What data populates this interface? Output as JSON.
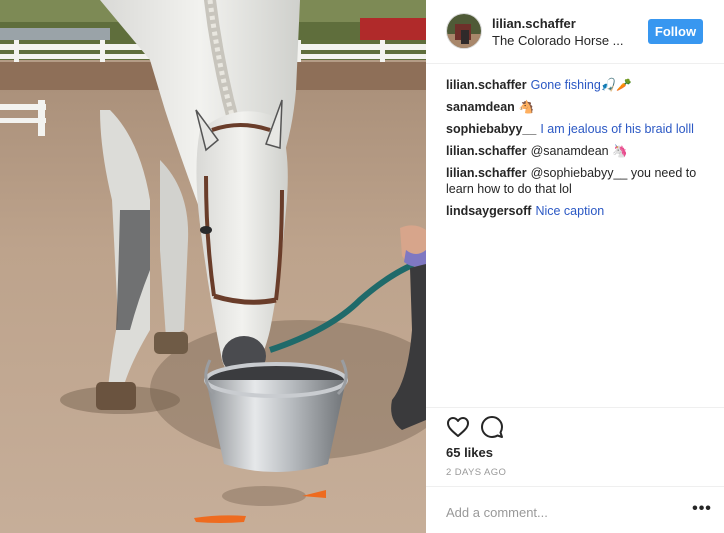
{
  "post": {
    "photo_alt": "",
    "author": {
      "username": "lilian.schaffer",
      "location": "The Colorado Horse ...",
      "follow_label": "Follow"
    },
    "comments": [
      {
        "user": "lilian.schaffer",
        "text": "Gone fishing🎣🥕"
      },
      {
        "user": "sanamdean",
        "text": "🐴"
      },
      {
        "user": "sophiebabyy__",
        "text": "I am jealous of his braid lolll"
      },
      {
        "user": "lilian.schaffer",
        "text": "@sanamdean 🦄"
      },
      {
        "user": "lilian.schaffer",
        "text": "@sophiebabyy__ you need to learn how to do that lol"
      },
      {
        "user": "lindsaygersoff",
        "text": "Nice caption"
      }
    ],
    "icons": {
      "like": "heart-icon",
      "comment": "comment-bubble-icon",
      "more": "more-options-icon"
    },
    "likes_label": "65 likes",
    "date_label": "2 DAYS AGO",
    "add_comment_placeholder": "Add a comment...",
    "more_label": "•••",
    "colors": {
      "follow_button": "#3897f0",
      "comment_text": "#2b58c4",
      "muted": "#999999"
    }
  }
}
